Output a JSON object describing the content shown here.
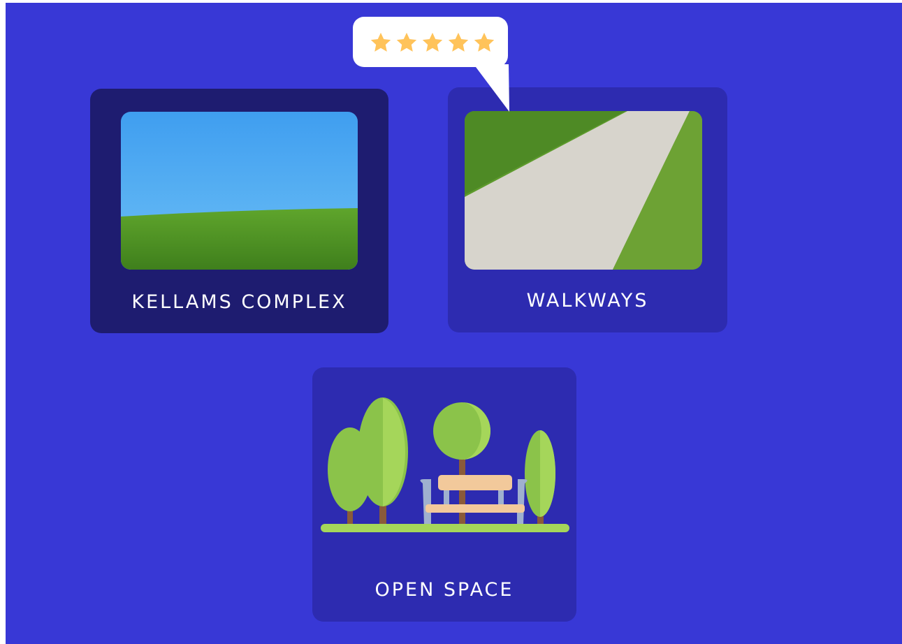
{
  "colors": {
    "background": "#3838d6",
    "card_dark": "#1e1c70",
    "card_mid": "#2d2bb0",
    "star": "#ffc35a"
  },
  "cards": [
    {
      "label": "KELLAMS COMPLEX",
      "image": "grass-field-blue-sky-photo"
    },
    {
      "label": "WALKWAYS",
      "image": "concrete-walkway-photo"
    },
    {
      "label": "OPEN SPACE",
      "image": "park-trees-bench-illustration"
    }
  ],
  "rating": {
    "stars": 5,
    "max": 5,
    "icon": "star-icon"
  }
}
